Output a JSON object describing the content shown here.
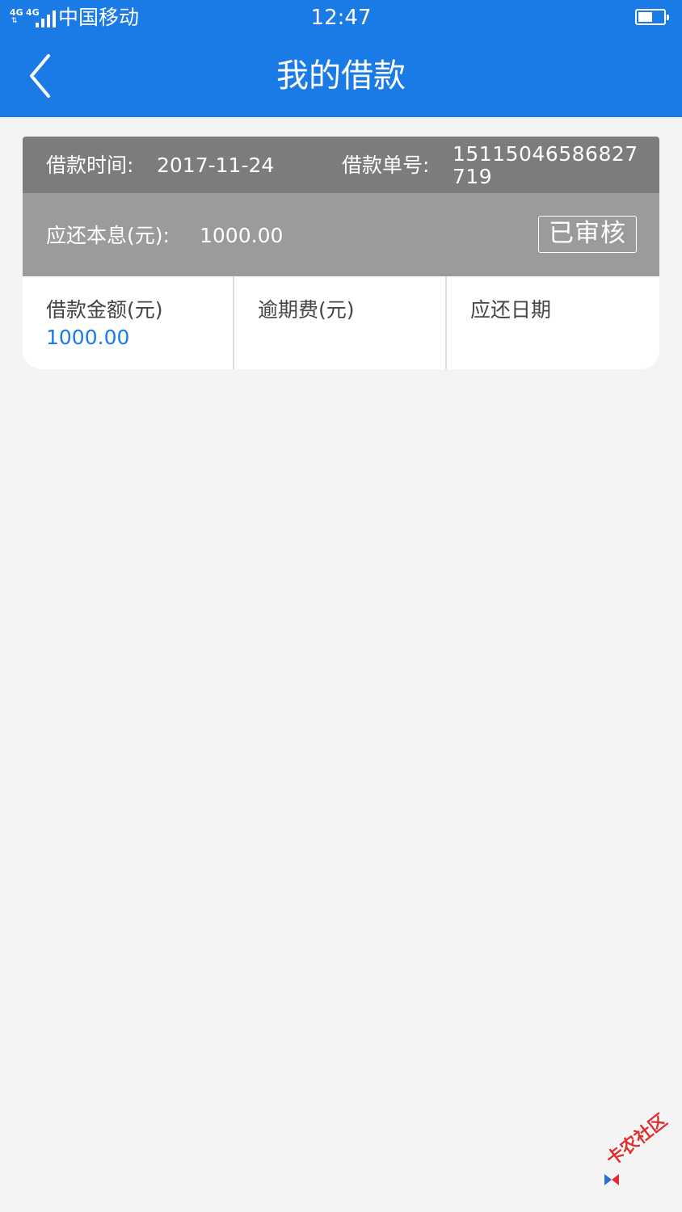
{
  "status_bar": {
    "network_1": "4G",
    "network_2": "4G",
    "carrier": "中国移动",
    "time": "12:47",
    "battery_level": 0.55,
    "signal_bars": 4
  },
  "navbar": {
    "title": "我的借款",
    "back_icon": "chevron-left-icon"
  },
  "loan": {
    "time_label": "借款时间:",
    "time_value": "2017-11-24",
    "order_label": "借款单号:",
    "order_value": "15115046586827719",
    "due_amount_label": "应还本息(元):",
    "due_amount_value": "1000.00",
    "status": "已审核",
    "amount_label": "借款金额(元)",
    "amount_value": "1000.00",
    "overdue_fee_label": "逾期费(元)",
    "due_date_label": "应还日期"
  },
  "watermark": {
    "text": "卡农社区"
  },
  "colors": {
    "brand_blue": "#1a7ae6",
    "header_dark_gray": "#7c7c7c",
    "header_light_gray": "#9b9b9b",
    "page_background": "#f4f4f4",
    "watermark_red": "#e03030"
  }
}
